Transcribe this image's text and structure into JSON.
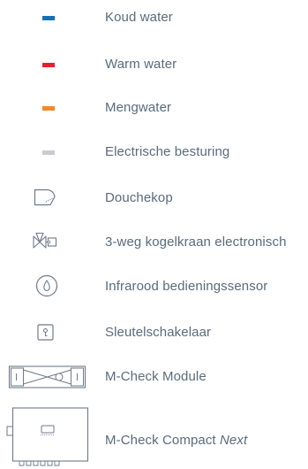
{
  "legend": {
    "items": [
      {
        "label": "Koud water",
        "color": "#1a6fb0",
        "icon": "cold-water-line-swatch"
      },
      {
        "label": "Warm water",
        "color": "#e3222c",
        "icon": "warm-water-line-swatch"
      },
      {
        "label": "Mengwater",
        "color": "#f08a2c",
        "icon": "mixed-water-line-swatch"
      },
      {
        "label": "Electrische besturing",
        "color": "#c9ccd1",
        "icon": "electric-control-line-swatch"
      },
      {
        "label": "Douchekop",
        "icon": "shower-head-icon"
      },
      {
        "label": "3-weg kogelkraan electronisch",
        "icon": "three-way-ball-valve-icon"
      },
      {
        "label": "Infrarood bedieningssensor",
        "icon": "infrared-sensor-icon"
      },
      {
        "label": "Sleutelschakelaar",
        "icon": "key-switch-icon"
      },
      {
        "label": "M-Check Module",
        "icon": "m-check-module-icon"
      },
      {
        "label_main": "M-Check Compact",
        "label_suffix": "Next",
        "icon": "m-check-compact-next-icon"
      }
    ]
  }
}
